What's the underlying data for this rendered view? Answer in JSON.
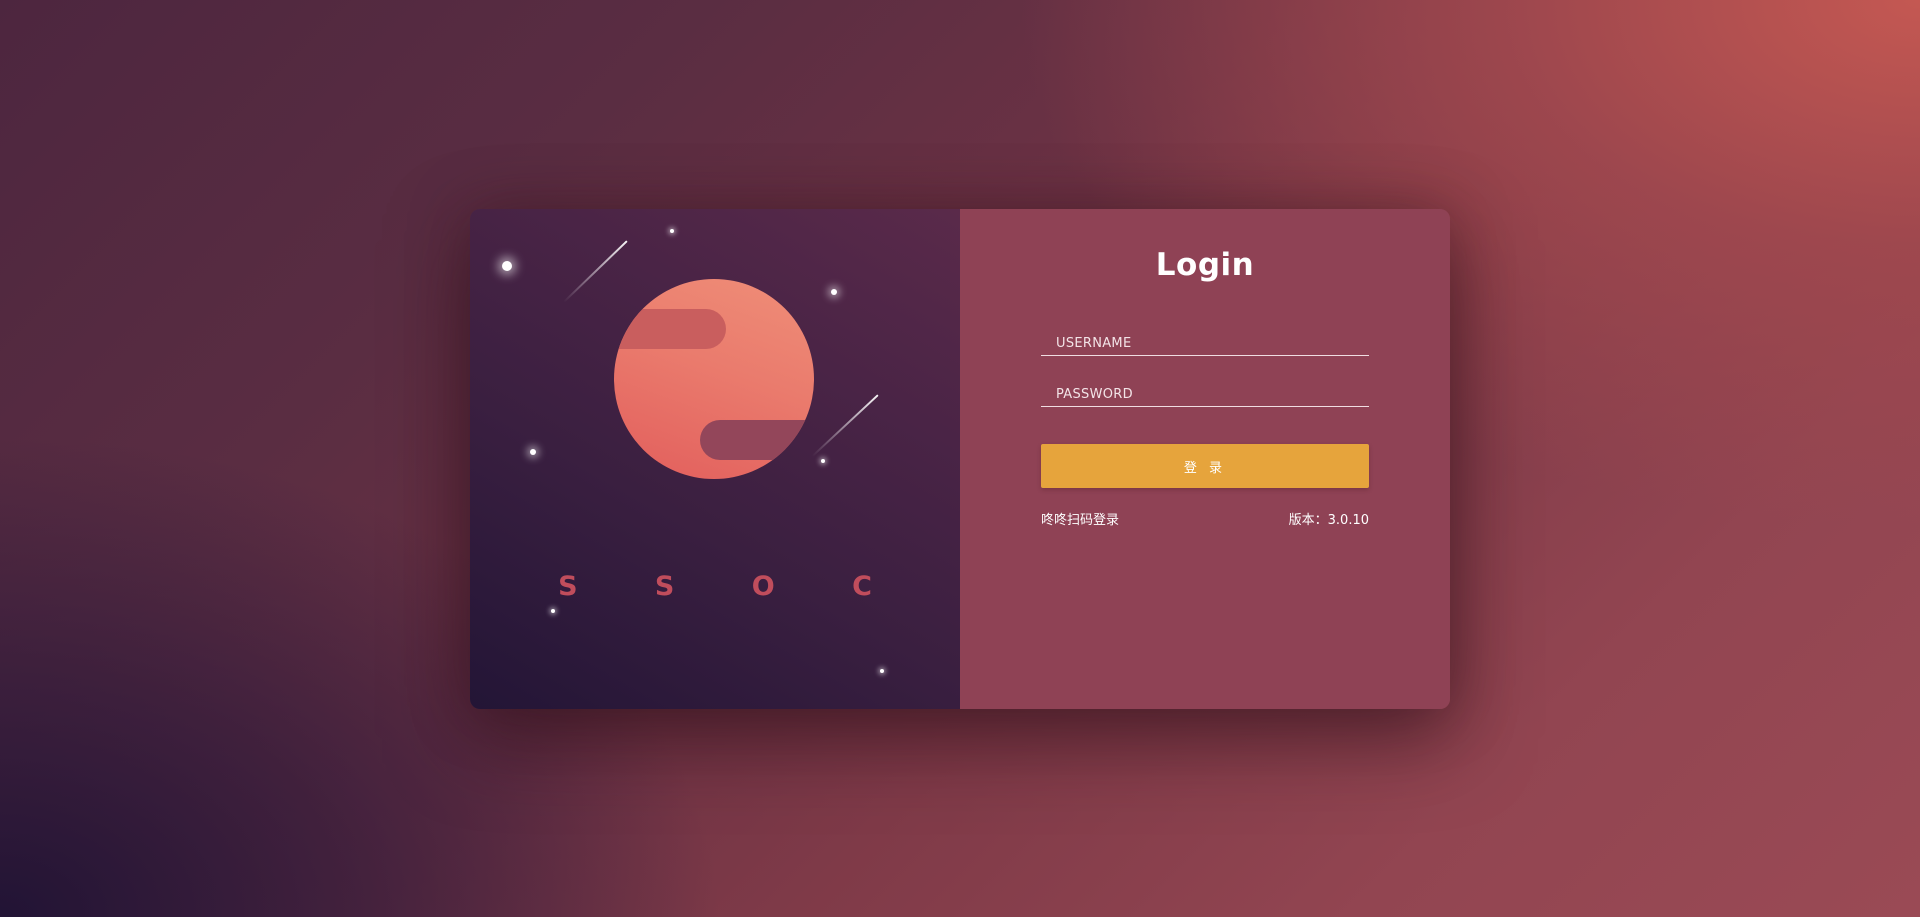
{
  "brand": {
    "name": "S S O C",
    "colors": {
      "planet_top": "#ef8e78",
      "planet_bottom": "#e25e5c",
      "brand_text": "#c04d5c"
    }
  },
  "login": {
    "title": "Login",
    "username_placeholder": "USERNAME",
    "password_placeholder": "PASSWORD",
    "submit_label": "登 录",
    "qr_login_label": "咚咚扫码登录",
    "version_label": "版本：3.0.10"
  },
  "colors": {
    "accent": "#e6a43c",
    "panel_right": "#8f4255"
  }
}
